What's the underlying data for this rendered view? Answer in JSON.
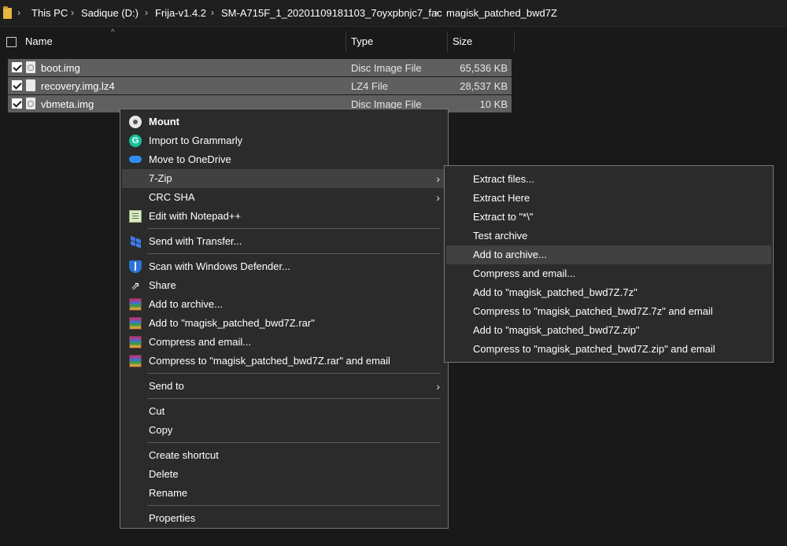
{
  "breadcrumb": {
    "items": [
      "This PC",
      "Sadique (D:)",
      "Frija-v1.4.2",
      "SM-A715F_1_20201109181103_7oyxpbnjc7_fac",
      "magisk_patched_bwd7Z"
    ]
  },
  "columns": {
    "name": "Name",
    "type": "Type",
    "size": "Size"
  },
  "files": [
    {
      "name": "boot.img",
      "type": "Disc Image File",
      "size": "65,536 KB"
    },
    {
      "name": "recovery.img.lz4",
      "type": "LZ4 File",
      "size": "28,537 KB"
    },
    {
      "name": "vbmeta.img",
      "type": "Disc Image File",
      "size": "10 KB"
    }
  ],
  "context_menu": {
    "items": [
      {
        "label": "Mount",
        "icon": "disc-icon"
      },
      {
        "label": "Import to Grammarly",
        "icon": "grammarly-icon"
      },
      {
        "label": "Move to OneDrive",
        "icon": "onedrive-icon"
      },
      {
        "label": "7-Zip",
        "icon": "",
        "submenu": true
      },
      {
        "label": "CRC SHA",
        "icon": "",
        "submenu": true
      },
      {
        "label": "Edit with Notepad++",
        "icon": "notepad-icon"
      },
      {
        "label": "Send with Transfer...",
        "icon": "dropbox-icon"
      },
      {
        "label": "Scan with Windows Defender...",
        "icon": "defender-icon"
      },
      {
        "label": "Share",
        "icon": "share-icon"
      },
      {
        "label": "Add to archive...",
        "icon": "winrar-icon"
      },
      {
        "label": "Add to \"magisk_patched_bwd7Z.rar\"",
        "icon": "winrar-icon"
      },
      {
        "label": "Compress and email...",
        "icon": "winrar-icon"
      },
      {
        "label": "Compress to \"magisk_patched_bwd7Z.rar\" and email",
        "icon": "winrar-icon"
      },
      {
        "label": "Send to",
        "icon": "",
        "submenu": true
      },
      {
        "label": "Cut",
        "icon": ""
      },
      {
        "label": "Copy",
        "icon": ""
      },
      {
        "label": "Create shortcut",
        "icon": ""
      },
      {
        "label": "Delete",
        "icon": ""
      },
      {
        "label": "Rename",
        "icon": ""
      },
      {
        "label": "Properties",
        "icon": ""
      }
    ],
    "highlighted": "7-Zip"
  },
  "submenu_7zip": {
    "items": [
      "Extract files...",
      "Extract Here",
      "Extract to \"*\\\"",
      "Test archive",
      "Add to archive...",
      "Compress and email...",
      "Add to \"magisk_patched_bwd7Z.7z\"",
      "Compress to \"magisk_patched_bwd7Z.7z\" and email",
      "Add to \"magisk_patched_bwd7Z.zip\"",
      "Compress to \"magisk_patched_bwd7Z.zip\" and email"
    ],
    "highlighted": "Add to archive..."
  },
  "colors": {
    "background": "#191919",
    "menu_bg": "#2b2b2b",
    "menu_border": "#767676",
    "highlight": "#414141",
    "selected_row": "#5f5f5f"
  }
}
